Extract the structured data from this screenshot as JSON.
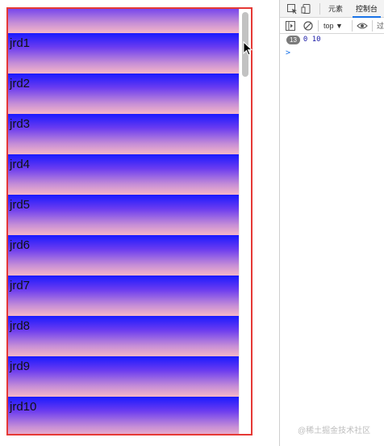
{
  "list": {
    "items": [
      "",
      "jrd1",
      "jrd2",
      "jrd3",
      "jrd4",
      "jrd5",
      "jrd6",
      "jrd7",
      "jrd8",
      "jrd9",
      "jrd10"
    ],
    "gradient_colors": [
      "#1a1aff",
      "#6b3cf0",
      "#c78fd6",
      "#f5b7c8"
    ],
    "frame_color": "#e53935"
  },
  "devtools": {
    "tabs": {
      "elements": "元素",
      "console": "控制台",
      "more": ""
    },
    "toolbar": {
      "context": "top ▼",
      "filter": "过"
    },
    "log": {
      "count": "13",
      "text": "0 10"
    },
    "prompt": ">"
  },
  "watermark": "@稀土掘金技术社区"
}
